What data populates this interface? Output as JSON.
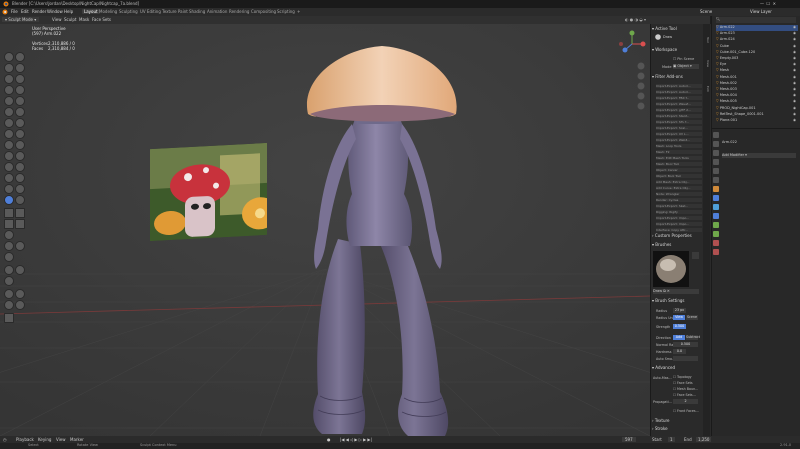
{
  "window": {
    "title": "Blender [C:\\Users\\Jordan\\Desktop\\NightCap\\Nightcap_7a.blend]"
  },
  "menu": {
    "items": [
      "File",
      "Edit",
      "Render",
      "Window",
      "Help"
    ],
    "workspaces": [
      "Layout",
      "Modeling",
      "Sculpting",
      "UV Editing",
      "Texture Paint",
      "Shading",
      "Animation",
      "Rendering",
      "Compositing",
      "Scripting"
    ],
    "active_workspace": "Layout",
    "scene": "Scene",
    "view_layer": "View Layer"
  },
  "header": {
    "mode": "Sculpt Mode",
    "items": [
      "View",
      "Sculpt",
      "Mask",
      "Face Sets"
    ]
  },
  "viewport": {
    "perspective": "User Perspective",
    "object_label": "(597) Arm.022",
    "vertices_label": "Vertices",
    "vertices_value": "2,310,886 / 0",
    "faces_label": "Faces",
    "faces_value": "2,310,884 / 0"
  },
  "properties_panel": {
    "active_tool_label": "Active Tool",
    "tool_name": "Draw",
    "workspace_label": "Workspace",
    "pin_scene_label": "Pin Scene",
    "mode_label": "Mode",
    "mode_value": "Object",
    "filter_addons_label": "Filter Add-ons",
    "addons": [
      "Import-Export: Autod...",
      "Import-Export: Autod...",
      "Import-Export: FBX f...",
      "Import-Export: Wavef...",
      "Import-Export: gITF 2...",
      "Import-Export: Stanf...",
      "Import-Export: STL f...",
      "Import-Export: Scal...",
      "Import-Export: UV L...",
      "Import-Export: Web3...",
      "Mesh: Loop Tools",
      "Mesh: F2",
      "Mesh: Edit Mesh Tools",
      "Mesh: Bool Tool",
      "Object: Carver",
      "Object: Bool Tool",
      "Add Mesh: Extra Obj...",
      "Add Curve: Extra Obj...",
      "Node: Wrangler",
      "Render: Cycles",
      "Import-Export: Sket...",
      "Rigging: Rigify",
      "Import-Export: Impo...",
      "Import-Export: Impo...",
      "Interface: Copy Attr..."
    ],
    "custom_properties_label": "Custom Properties",
    "brushes_label": "Brushes",
    "brush_name": "Draw",
    "brush_settings_label": "Brush Settings",
    "radius_label": "Radius",
    "radius_value": "23 px",
    "radius_unit_label": "Radius Unit",
    "radius_unit_view": "View",
    "radius_unit_scene": "Scene",
    "strength_label": "Strength",
    "strength_value": "0.500",
    "direction_label": "Direction",
    "direction_add": "Add",
    "direction_subtract": "Subtract",
    "normal_radius_label": "Normal Ra...",
    "normal_radius_value": "0.500",
    "hardness_label": "Hardness",
    "hardness_value": "0.0",
    "autosmooth_label": "Auto Smo...",
    "advanced_label": "Advanced",
    "auto_masking_label": "Auto-Mas...",
    "topology_label": "Topology",
    "face_sets_label": "Face Sets",
    "mesh_boundary_label": "Mesh Boun...",
    "face_sets_boundary_label": "Face Sets...",
    "propagate_label": "Propagati...",
    "propagate_value": "2",
    "front_faces_label": "Front Faces...",
    "texture_label": "Texture",
    "stroke_label": "Stroke"
  },
  "outliner": {
    "rows": [
      {
        "name": "Arm.022",
        "selected": true
      },
      {
        "name": "Arm.023",
        "selected": false
      },
      {
        "name": "Arm.024",
        "selected": false
      },
      {
        "name": "Cube",
        "selected": false
      },
      {
        "name": "Cube.001_Cube.120",
        "selected": false
      },
      {
        "name": "Empty.003",
        "selected": false
      },
      {
        "name": "Eye",
        "selected": false
      },
      {
        "name": "Mesh",
        "selected": false
      },
      {
        "name": "Mesh.001",
        "selected": false
      },
      {
        "name": "Mesh.002",
        "selected": false
      },
      {
        "name": "Mesh.003",
        "selected": false
      },
      {
        "name": "Mesh.004",
        "selected": false
      },
      {
        "name": "Mesh.005",
        "selected": false
      },
      {
        "name": "PROD_NightCap.001",
        "selected": false
      },
      {
        "name": "RetTest_Shape_0001.001",
        "selected": false
      },
      {
        "name": "Plane.001",
        "selected": false
      }
    ]
  },
  "object_props": {
    "object_name": "Arm.022",
    "modifier_label": "Add Modifier"
  },
  "timeline": {
    "playback": "Playback",
    "keying": "Keying",
    "view": "View",
    "marker": "Marker",
    "frame": "597",
    "start_label": "Start",
    "start_value": "1",
    "end_label": "End",
    "end_value": "1,250"
  },
  "status": {
    "select": "Select",
    "rotate": "Rotate View",
    "context": "Sculpt Context Menu",
    "version": "2.91.0"
  },
  "colors": {
    "accent": "#4f7fd9",
    "viewport_bg": "#3d3d3d",
    "panel_bg": "#2a2a2a"
  }
}
